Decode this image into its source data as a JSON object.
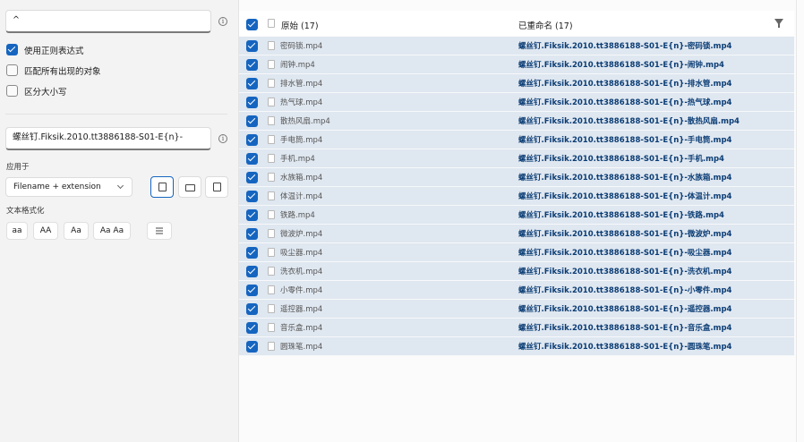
{
  "search": {
    "value": "^"
  },
  "options": [
    {
      "label": "使用正则表达式",
      "checked": true
    },
    {
      "label": "匹配所有出现的对象",
      "checked": false
    },
    {
      "label": "区分大小写",
      "checked": false
    }
  ],
  "replace": {
    "value": "螺丝钉.Fiksik.2010.tt3886188-S01-E{n}-"
  },
  "apply_to": {
    "label": "应用于",
    "selected": "Filename + extension",
    "buttons": [
      "file-icon",
      "folder-icon",
      "file-copy-icon"
    ]
  },
  "text_format": {
    "label": "文本格式化",
    "buttons": [
      "aa",
      "AA",
      "Aa",
      "Aa Aa"
    ]
  },
  "list": {
    "header_original": "原始 (17)",
    "header_renamed": "已重命名 (17)",
    "rows": [
      {
        "original": "密码锁.mp4",
        "renamed": "螺丝钉.Fiksik.2010.tt3886188-S01-E{n}-密码锁.mp4"
      },
      {
        "original": "闹钟.mp4",
        "renamed": "螺丝钉.Fiksik.2010.tt3886188-S01-E{n}-闹钟.mp4"
      },
      {
        "original": "排水管.mp4",
        "renamed": "螺丝钉.Fiksik.2010.tt3886188-S01-E{n}-排水管.mp4"
      },
      {
        "original": "热气球.mp4",
        "renamed": "螺丝钉.Fiksik.2010.tt3886188-S01-E{n}-热气球.mp4"
      },
      {
        "original": "散热风扇.mp4",
        "renamed": "螺丝钉.Fiksik.2010.tt3886188-S01-E{n}-散热风扇.mp4"
      },
      {
        "original": "手电筒.mp4",
        "renamed": "螺丝钉.Fiksik.2010.tt3886188-S01-E{n}-手电筒.mp4"
      },
      {
        "original": "手机.mp4",
        "renamed": "螺丝钉.Fiksik.2010.tt3886188-S01-E{n}-手机.mp4"
      },
      {
        "original": "水族箱.mp4",
        "renamed": "螺丝钉.Fiksik.2010.tt3886188-S01-E{n}-水族箱.mp4"
      },
      {
        "original": "体温计.mp4",
        "renamed": "螺丝钉.Fiksik.2010.tt3886188-S01-E{n}-体温计.mp4"
      },
      {
        "original": "铁路.mp4",
        "renamed": "螺丝钉.Fiksik.2010.tt3886188-S01-E{n}-铁路.mp4"
      },
      {
        "original": "微波炉.mp4",
        "renamed": "螺丝钉.Fiksik.2010.tt3886188-S01-E{n}-微波炉.mp4"
      },
      {
        "original": "吸尘器.mp4",
        "renamed": "螺丝钉.Fiksik.2010.tt3886188-S01-E{n}-吸尘器.mp4"
      },
      {
        "original": "洗衣机.mp4",
        "renamed": "螺丝钉.Fiksik.2010.tt3886188-S01-E{n}-洗衣机.mp4"
      },
      {
        "original": "小零件.mp4",
        "renamed": "螺丝钉.Fiksik.2010.tt3886188-S01-E{n}-小零件.mp4"
      },
      {
        "original": "遥控器.mp4",
        "renamed": "螺丝钉.Fiksik.2010.tt3886188-S01-E{n}-遥控器.mp4"
      },
      {
        "original": "音乐盒.mp4",
        "renamed": "螺丝钉.Fiksik.2010.tt3886188-S01-E{n}-音乐盒.mp4"
      },
      {
        "original": "圆珠笔.mp4",
        "renamed": "螺丝钉.Fiksik.2010.tt3886188-S01-E{n}-圆珠笔.mp4"
      }
    ]
  },
  "colors": {
    "accent": "#1565c0",
    "row_selected": "#dfe7f0",
    "renamed_text": "#0b3d75"
  }
}
